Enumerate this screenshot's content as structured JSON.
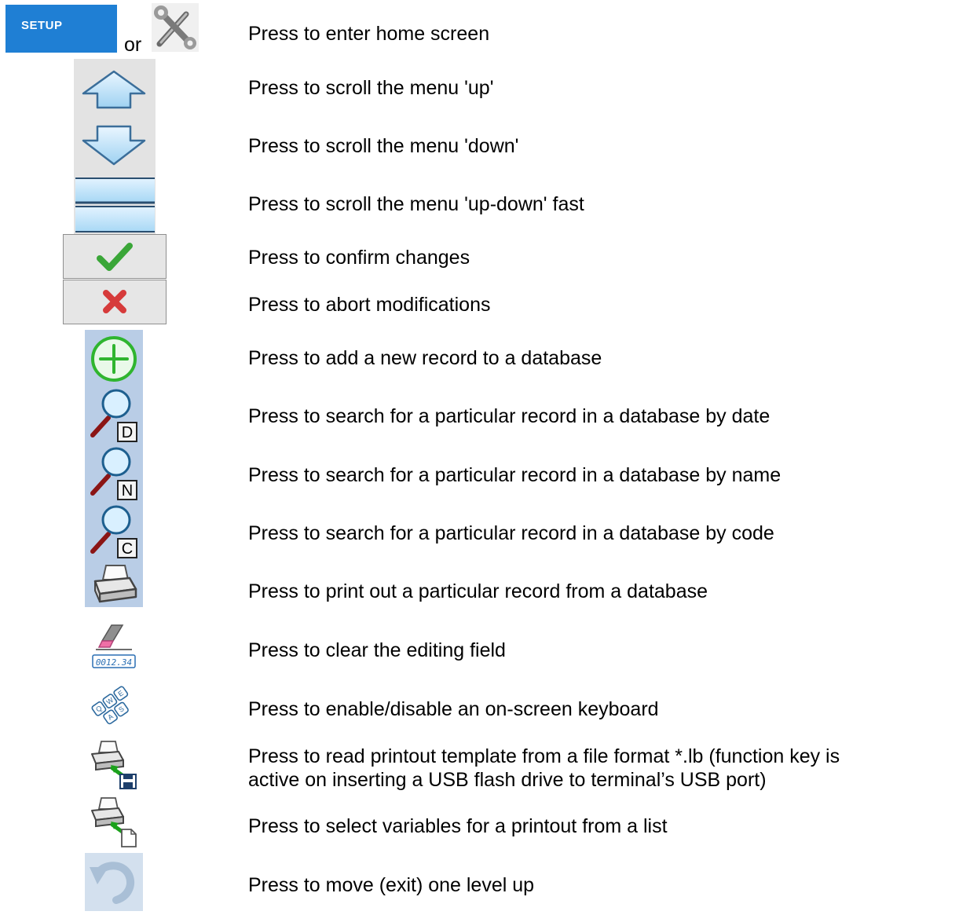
{
  "setup_button": {
    "label": "SETUP"
  },
  "or_text": "or",
  "icons": {
    "setup": "setup-button",
    "tools": "tools-icon",
    "up": "arrow-up-icon",
    "down": "arrow-down-icon",
    "fast": "fast-scroll-icon",
    "confirm": "checkmark-icon",
    "abort": "x-icon",
    "add": "plus-icon",
    "search_date": "search-date-icon",
    "search_name": "search-name-icon",
    "search_code": "search-code-icon",
    "print": "printer-icon",
    "clear": "eraser-icon",
    "keyboard": "keyboard-icon",
    "read_template": "printer-save-icon",
    "select_vars": "printer-file-icon",
    "back": "back-arrow-icon"
  },
  "key_letters": {
    "date": "D",
    "name": "N",
    "code": "C"
  },
  "clear_display": "0012.34",
  "keyboard_letters": [
    "Q",
    "W",
    "E",
    "A",
    "S"
  ],
  "rows": [
    {
      "text": "Press to enter home screen"
    },
    {
      "text": "Press to scroll the menu 'up'"
    },
    {
      "text": "Press to scroll the menu 'down'"
    },
    {
      "text": "Press to scroll the menu 'up-down' fast"
    },
    {
      "text": "Press to confirm changes"
    },
    {
      "text": "Press to abort modifications"
    },
    {
      "text": "Press to add a new record to a database"
    },
    {
      "text": "Press to search for a particular record in a database by date"
    },
    {
      "text": "Press to search for a particular record in a database by name"
    },
    {
      "text": "Press to search for a particular record in a database by code"
    },
    {
      "text": "Press to print out a particular record from a database"
    },
    {
      "text": "Press to clear the editing field"
    },
    {
      "text": "Press to enable/disable an on-screen keyboard"
    },
    {
      "text": "Press to read printout template from a file format *.lb (function key is",
      "text2": "active on inserting a USB flash drive to terminal’s USB port)"
    },
    {
      "text": "Press to select variables for a printout from a list"
    },
    {
      "text": "Press to move (exit) one level up"
    }
  ]
}
